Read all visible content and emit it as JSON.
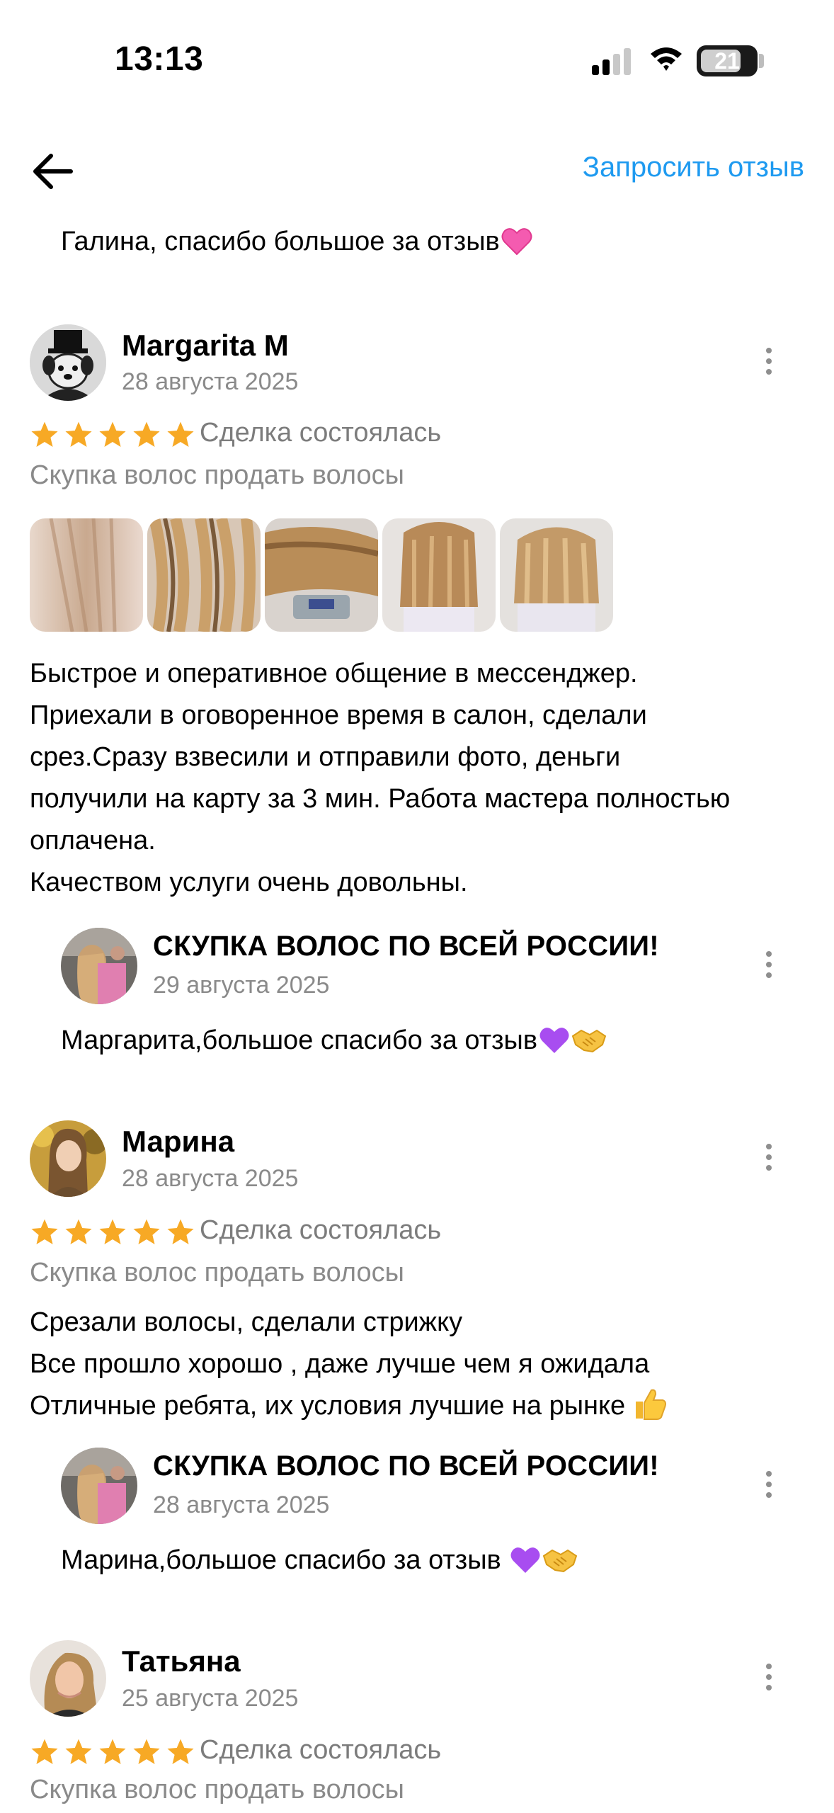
{
  "status_bar": {
    "time": "13:13",
    "battery": "21"
  },
  "header": {
    "request_label": "Запросить отзыв"
  },
  "top_reply": {
    "text": "Галина, спасибо большое за отзыв"
  },
  "reviews": [
    {
      "name": "Margarita M",
      "date": "28 августа 2025",
      "rating": 5,
      "deal": "Сделка состоялась",
      "category": "Скупка волос продать волосы",
      "photos": 5,
      "lines": [
        "Быстрое и оперативное общение в мессенджер.",
        "Приехали в оговоренное время в салон, сделали",
        "срез.Сразу взвесили и отправили фото, деньги",
        "получили на карту за 3 мин. Работа мастера полностью",
        "оплачена.",
        "Качеством услуги очень довольны."
      ],
      "reply": {
        "name": "СКУПКА ВОЛОС ПО ВСЕЙ РОССИИ!",
        "date": "29 августа 2025",
        "text": "Маргарита,большое спасибо за отзыв"
      }
    },
    {
      "name": "Марина",
      "date": "28 августа 2025",
      "rating": 5,
      "deal": "Сделка состоялась",
      "category": "Скупка волос продать волосы",
      "lines": [
        "Срезали волосы, сделали стрижку",
        "Все прошло хорошо , даже лучше чем я ожидала",
        "Отличные ребята, их условия лучшие на рынке"
      ],
      "reply": {
        "name": "СКУПКА ВОЛОС ПО ВСЕЙ РОССИИ!",
        "date": "28 августа 2025",
        "text": "Марина,большое спасибо за отзыв "
      }
    },
    {
      "name": "Татьяна",
      "date": "25 августа 2025",
      "rating": 5,
      "deal": "Сделка состоялась",
      "category": "Скупка волос продать волосы"
    }
  ],
  "colors": {
    "accent": "#1e9af0",
    "star": "#f7a925",
    "muted": "#8a8a8a"
  },
  "icons": [
    "back-arrow-icon",
    "kebab-menu-icon",
    "star-icon",
    "pink-heart-emoji",
    "purple-heart-emoji",
    "handshake-emoji",
    "thumbs-up-emoji"
  ]
}
